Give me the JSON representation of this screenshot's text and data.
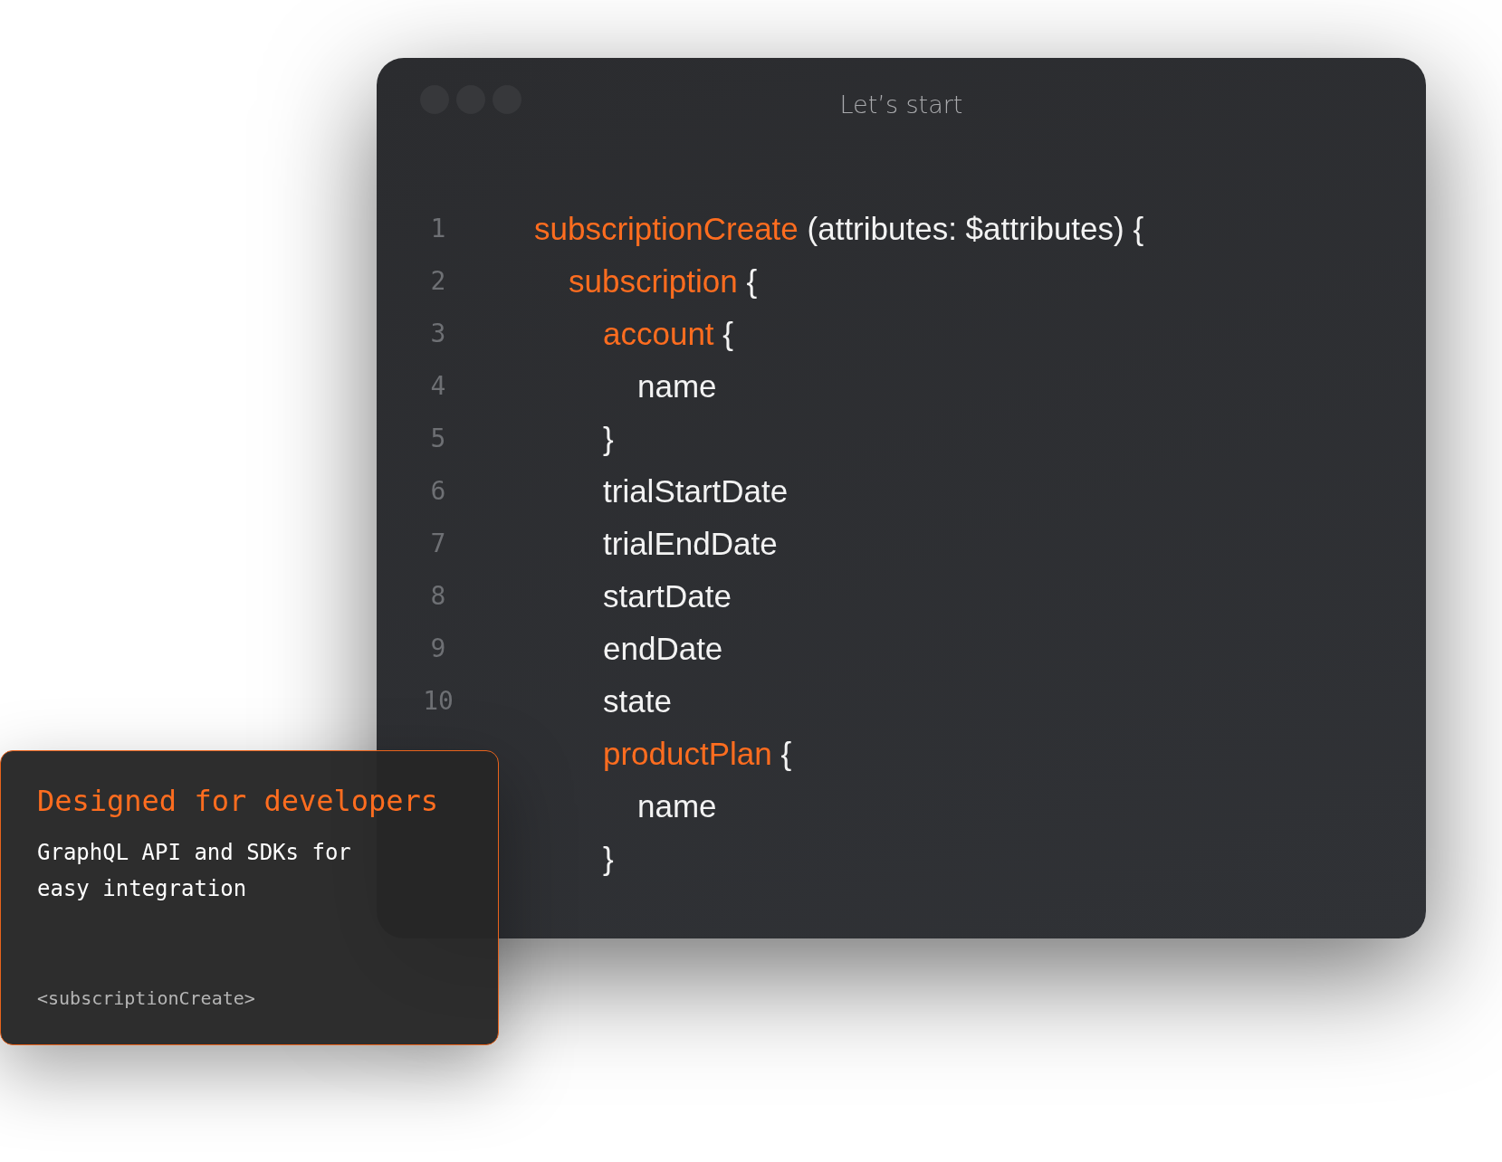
{
  "window": {
    "title": "Let’s start"
  },
  "code": {
    "lines": [
      {
        "number": "1",
        "tokens": [
          {
            "text": "subscriptionCreate",
            "kind": "keyword"
          },
          {
            "text": " (attributes: $attributes) {",
            "kind": "plain"
          }
        ],
        "children": [
          {
            "number": "2",
            "tokens": [
              {
                "text": "subscription",
                "kind": "keyword"
              },
              {
                "text": " {",
                "kind": "plain"
              }
            ],
            "children": [
              {
                "number": "3",
                "tokens": [
                  {
                    "text": "account",
                    "kind": "keyword"
                  },
                  {
                    "text": " {",
                    "kind": "plain"
                  }
                ],
                "children": [
                  {
                    "number": "4",
                    "tokens": [
                      {
                        "text": "name",
                        "kind": "plain"
                      }
                    ]
                  }
                ]
              },
              {
                "number": "5",
                "tokens": [
                  {
                    "text": "}",
                    "kind": "plain"
                  }
                ]
              },
              {
                "number": "6",
                "tokens": [
                  {
                    "text": "trialStartDate",
                    "kind": "plain"
                  }
                ]
              },
              {
                "number": "7",
                "tokens": [
                  {
                    "text": "trialEndDate",
                    "kind": "plain"
                  }
                ]
              },
              {
                "number": "8",
                "tokens": [
                  {
                    "text": "startDate",
                    "kind": "plain"
                  }
                ]
              },
              {
                "number": "9",
                "tokens": [
                  {
                    "text": "endDate",
                    "kind": "plain"
                  }
                ]
              },
              {
                "number": "10",
                "tokens": [
                  {
                    "text": "state",
                    "kind": "plain"
                  }
                ]
              },
              {
                "tokens": [
                  {
                    "text": "productPlan",
                    "kind": "keyword"
                  },
                  {
                    "text": " {",
                    "kind": "plain"
                  }
                ],
                "children": [
                  {
                    "tokens": [
                      {
                        "text": "name",
                        "kind": "plain"
                      }
                    ]
                  }
                ]
              },
              {
                "tokens": [
                  {
                    "text": "}",
                    "kind": "plain"
                  }
                ]
              }
            ]
          }
        ]
      }
    ]
  },
  "card": {
    "title": "Designed for developers",
    "text": "GraphQL API and SDKs for easy integration",
    "tag": "<subscriptionCreate>"
  }
}
